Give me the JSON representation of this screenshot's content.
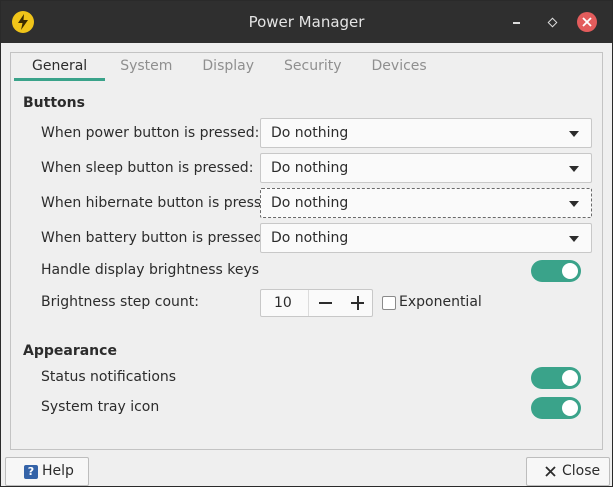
{
  "window": {
    "title": "Power Manager"
  },
  "tabs": [
    {
      "label": "General",
      "active": true
    },
    {
      "label": "System",
      "active": false
    },
    {
      "label": "Display",
      "active": false
    },
    {
      "label": "Security",
      "active": false
    },
    {
      "label": "Devices",
      "active": false
    }
  ],
  "buttons_section": {
    "title": "Buttons",
    "power": {
      "label": "When power button is pressed:",
      "value": "Do nothing"
    },
    "sleep": {
      "label": "When sleep button is pressed:",
      "value": "Do nothing"
    },
    "hibernate": {
      "label": "When hibernate button is pressed:",
      "value": "Do nothing"
    },
    "battery": {
      "label": "When battery button is pressed:",
      "value": "Do nothing"
    },
    "brightness_keys": {
      "label": "Handle display brightness keys",
      "enabled": true
    },
    "step_count": {
      "label": "Brightness step count:",
      "value": "10"
    },
    "exponential": {
      "label": "Exponential",
      "checked": false
    }
  },
  "appearance_section": {
    "title": "Appearance",
    "status_notifications": {
      "label": "Status notifications",
      "enabled": true
    },
    "system_tray": {
      "label": "System tray icon",
      "enabled": true
    }
  },
  "footer": {
    "help_label": "Help",
    "help_icon_glyph": "?",
    "close_label": "Close"
  },
  "colors": {
    "accent": "#3aa38a",
    "titlebar": "#2f2f2f",
    "close_button": "#e35c5c",
    "app_icon": "#f0c419"
  }
}
